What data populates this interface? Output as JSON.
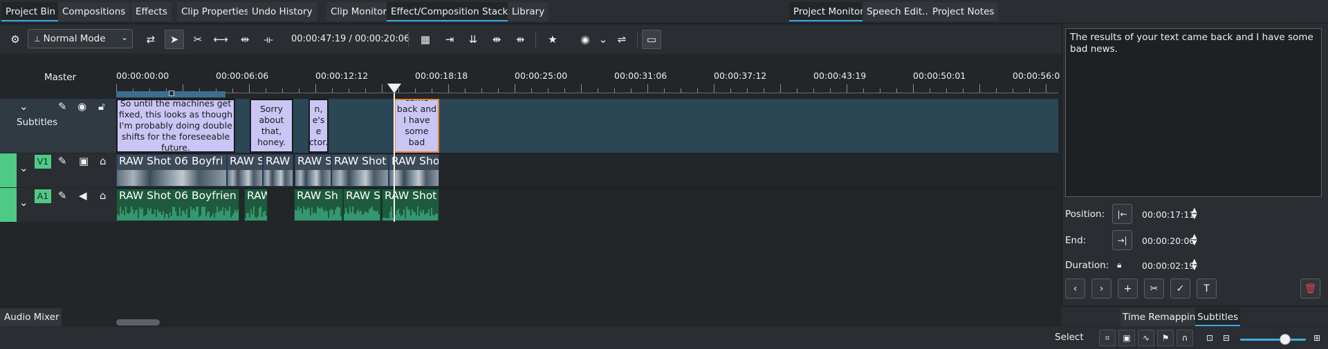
{
  "top_tabs": [
    {
      "label": "Project Bin",
      "active": true
    },
    {
      "label": "Compositions",
      "active": false
    },
    {
      "label": "Effects",
      "active": false
    },
    {
      "label": "Clip Properties",
      "active": false
    },
    {
      "label": "Undo History",
      "active": false
    },
    {
      "label": "Clip Monitor",
      "active": false
    },
    {
      "label": "Effect/Composition Stack",
      "active": true
    },
    {
      "label": "Library",
      "active": false
    },
    {
      "label": "Project Monitor",
      "active": true
    },
    {
      "label": "Speech Edit...",
      "active": false
    },
    {
      "label": "Project Notes",
      "active": false
    }
  ],
  "toolbar": {
    "mode": "Normal Mode",
    "timecode": "00:00:47:19 / 00:00:20:06",
    "icons": [
      "settings-sliders-icon",
      "spacer-tool-icon",
      "select-tool-icon",
      "razor-tool-icon",
      "slip-tool-icon",
      "ripple-tool-icon",
      "slide-tool-icon",
      "multicam-icon",
      "insert-icon",
      "overwrite-icon",
      "extract-icon",
      "lift-icon",
      "favorite-icon",
      "preview-render-icon",
      "mix-icon",
      "subtitle-toggle-icon"
    ]
  },
  "timeline": {
    "master_label": "Master",
    "ruler_labels": [
      "00:00:00:00",
      "00:00:06:06",
      "00:00:12:12",
      "00:00:18:18",
      "00:00:25:00",
      "00:00:31:06",
      "00:00:37:12",
      "00:00:43:19",
      "00:00:50:01",
      "00:00:56:0"
    ],
    "tracks": {
      "subtitles": {
        "name": "Subtitles"
      },
      "v1": {
        "tag": "V1"
      },
      "a1": {
        "tag": "A1"
      }
    },
    "subtitle_clips": [
      {
        "text": "So until the machines get fixed, this looks as though I'm probably doing double shifts for the foreseeable future.",
        "selected": false
      },
      {
        "text": "Sorry about that, honey.",
        "selected": false
      },
      {
        "text": "n, e's e ctor.",
        "selected": false
      },
      {
        "text": "came back and I have some bad news.",
        "selected": true
      }
    ],
    "video_clips": [
      "RAW Shot 06 Boyfri",
      "RAW S",
      "RAW",
      "RAW S",
      "RAW Shot",
      "RAW Sho"
    ],
    "audio_clips": [
      "RAW Shot 06 Boyfrien",
      "RAW",
      "RAW Sh",
      "RAW S",
      "RAW Shot"
    ]
  },
  "subtitle_editor": {
    "text": "The results of your text came back and I have some bad news.",
    "position_label": "Position:",
    "position_value": "00:00:17:11",
    "end_label": "End:",
    "end_value": "00:00:20:06",
    "duration_label": "Duration:",
    "duration_value": "00:00:02:19",
    "action_icons": [
      "previous-icon",
      "next-icon",
      "add-icon",
      "cut-icon",
      "apply-icon",
      "style-icon",
      "delete-icon"
    ]
  },
  "bottom_tabs": [
    {
      "label": "Audio Mixer",
      "active": false
    },
    {
      "label": "Time Remapping",
      "active": false
    },
    {
      "label": "Subtitles",
      "active": true
    }
  ],
  "status": {
    "text": "Select"
  },
  "colors": {
    "accent": "#3daee9",
    "track_green": "#4dcb84",
    "subtitle_clip": "#c9c6f5",
    "selected_border": "#e8862e",
    "audio_clip": "#1e5a3e"
  }
}
